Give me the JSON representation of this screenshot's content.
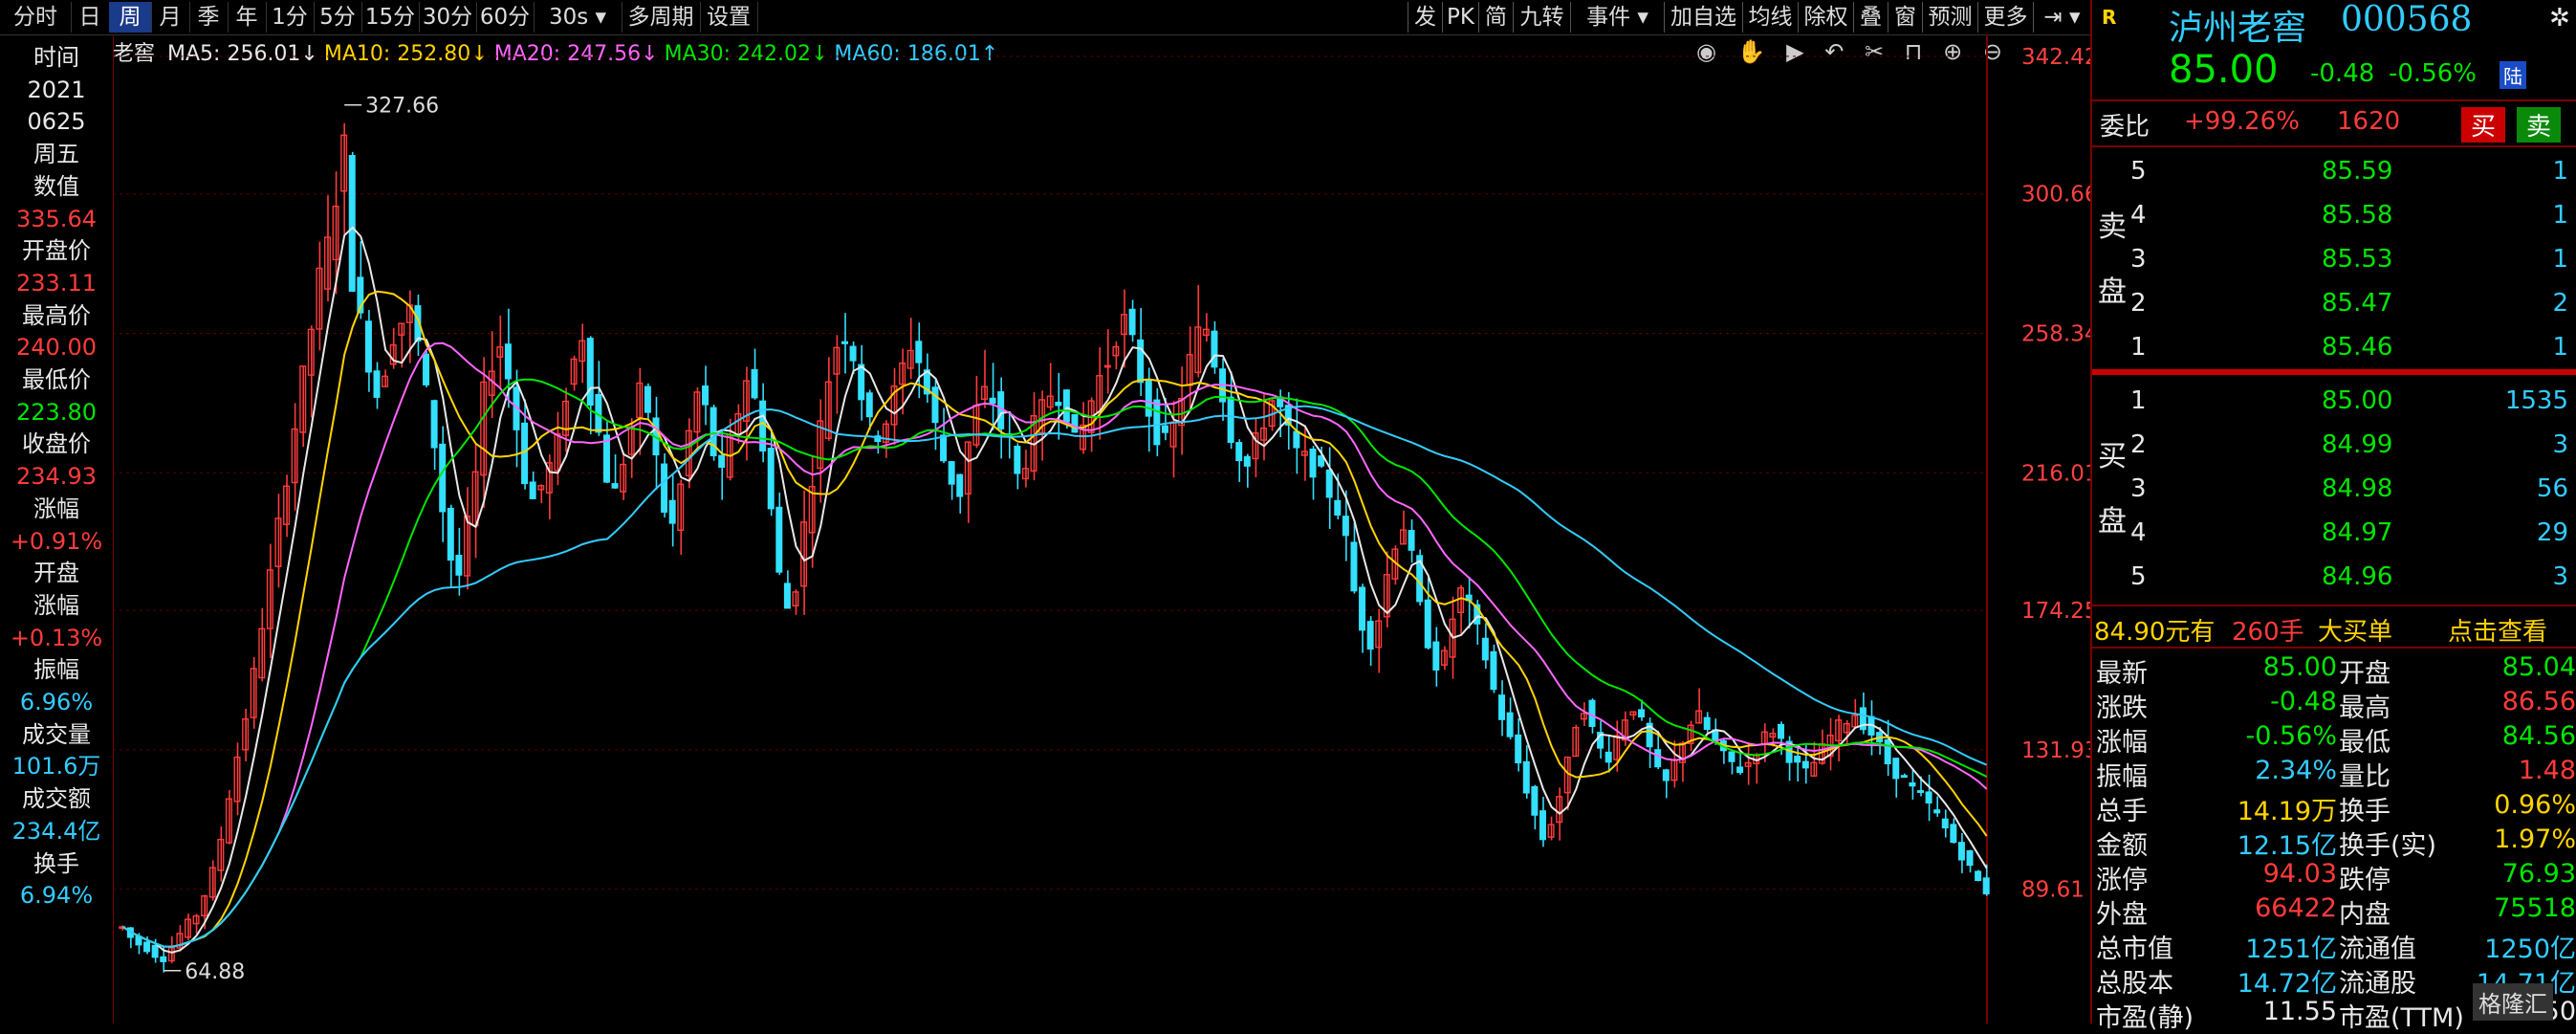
{
  "toolbar": {
    "left": [
      {
        "label": "分时",
        "w": 74
      },
      {
        "label": "日",
        "w": 40
      },
      {
        "label": "周",
        "w": 44,
        "active": true
      },
      {
        "label": "月",
        "w": 40
      },
      {
        "label": "季",
        "w": 40
      },
      {
        "label": "年",
        "w": 40
      },
      {
        "label": "1分",
        "w": 50
      },
      {
        "label": "5分",
        "w": 50
      },
      {
        "label": "15分",
        "w": 60
      },
      {
        "label": "30分",
        "w": 60
      },
      {
        "label": "60分",
        "w": 60
      },
      {
        "label": "30s ▾",
        "w": 92
      },
      {
        "label": "多周期",
        "w": 82
      },
      {
        "label": "设置",
        "w": 60
      }
    ],
    "right": [
      {
        "label": "发",
        "w": 36
      },
      {
        "label": "PK",
        "w": 38
      },
      {
        "label": "简",
        "w": 36
      },
      {
        "label": "九转",
        "w": 60
      },
      {
        "label": "事件 ▾",
        "w": 98
      },
      {
        "label": "加自选",
        "w": 82
      },
      {
        "label": "均线",
        "w": 58
      },
      {
        "label": "除权",
        "w": 58
      },
      {
        "label": "叠",
        "w": 36
      },
      {
        "label": "窗",
        "w": 36
      },
      {
        "label": "预测",
        "w": 58
      },
      {
        "label": "更多",
        "w": 58
      },
      {
        "label": "⇥ ▾",
        "w": 60
      }
    ]
  },
  "left_info": [
    {
      "text": "时间",
      "color": "#e8e8e8"
    },
    {
      "text": "2021",
      "color": "#e8e8e8"
    },
    {
      "text": "0625",
      "color": "#e8e8e8"
    },
    {
      "text": "周五",
      "color": "#e8e8e8"
    },
    {
      "text": "数值",
      "color": "#e8e8e8"
    },
    {
      "text": "335.64",
      "color": "#ff3b3b"
    },
    {
      "text": "开盘价",
      "color": "#e8e8e8"
    },
    {
      "text": "233.11",
      "color": "#ff3b3b"
    },
    {
      "text": "最高价",
      "color": "#e8e8e8"
    },
    {
      "text": "240.00",
      "color": "#ff3b3b"
    },
    {
      "text": "最低价",
      "color": "#e8e8e8"
    },
    {
      "text": "223.80",
      "color": "#00e600"
    },
    {
      "text": "收盘价",
      "color": "#e8e8e8"
    },
    {
      "text": "234.93",
      "color": "#ff3b3b"
    },
    {
      "text": "涨幅",
      "color": "#e8e8e8"
    },
    {
      "text": "+0.91%",
      "color": "#ff3b3b"
    },
    {
      "text": "开盘",
      "color": "#e8e8e8"
    },
    {
      "text": "涨幅",
      "color": "#e8e8e8"
    },
    {
      "text": "+0.13%",
      "color": "#ff3b3b"
    },
    {
      "text": "振幅",
      "color": "#e8e8e8"
    },
    {
      "text": "6.96%",
      "color": "#33ccff"
    },
    {
      "text": "成交量",
      "color": "#e8e8e8"
    },
    {
      "text": "101.6万",
      "color": "#33ccff"
    },
    {
      "text": "成交额",
      "color": "#e8e8e8"
    },
    {
      "text": "234.4亿",
      "color": "#33ccff"
    },
    {
      "text": "换手",
      "color": "#e8e8e8"
    },
    {
      "text": "6.94%",
      "color": "#33ccff"
    }
  ],
  "ma_legend": {
    "stock_short": "老窖",
    "items": [
      {
        "label": "MA5: 256.01↓",
        "color": "#e8e8e8"
      },
      {
        "label": "MA10: 252.80↓",
        "color": "#ffd400"
      },
      {
        "label": "MA20: 247.56↓",
        "color": "#ff66ff"
      },
      {
        "label": "MA30: 242.02↓",
        "color": "#00e600"
      },
      {
        "label": "MA60: 186.01↑",
        "color": "#33ccff"
      }
    ]
  },
  "chart_data": {
    "type": "candlestick",
    "period": "weekly",
    "y_ticks": [
      342.42,
      300.66,
      258.34,
      216.01,
      174.25,
      131.93,
      89.61
    ],
    "ylim": [
      50,
      345
    ],
    "annotations": [
      {
        "label": "327.66",
        "value": 327.66,
        "kind": "high"
      },
      {
        "label": "64.88",
        "value": 64.88,
        "kind": "low"
      }
    ],
    "close_path": [
      78,
      75,
      73,
      72,
      70,
      69,
      72,
      76,
      79,
      82,
      88,
      95,
      105,
      118,
      130,
      142,
      155,
      170,
      185,
      200,
      215,
      230,
      245,
      260,
      275,
      285,
      300,
      315,
      275,
      262,
      250,
      240,
      248,
      258,
      262,
      265,
      255,
      240,
      225,
      205,
      190,
      185,
      200,
      215,
      240,
      250,
      255,
      245,
      230,
      215,
      208,
      212,
      218,
      225,
      240,
      250,
      258,
      240,
      228,
      215,
      210,
      220,
      230,
      240,
      235,
      220,
      205,
      200,
      212,
      228,
      240,
      235,
      222,
      215,
      225,
      235,
      245,
      238,
      225,
      205,
      185,
      175,
      182,
      200,
      215,
      230,
      245,
      255,
      258,
      252,
      240,
      230,
      228,
      232,
      240,
      248,
      255,
      250,
      240,
      230,
      220,
      214,
      210,
      225,
      235,
      240,
      238,
      230,
      225,
      215,
      220,
      230,
      235,
      240,
      240,
      235,
      225,
      230,
      238,
      245,
      250,
      258,
      262,
      255,
      245,
      235,
      228,
      225,
      230,
      240,
      250,
      258,
      260,
      250,
      240,
      228,
      222,
      218,
      225,
      232,
      238,
      235,
      228,
      222,
      220,
      218,
      215,
      210,
      205,
      195,
      180,
      170,
      165,
      172,
      185,
      195,
      200,
      190,
      175,
      165,
      158,
      160,
      172,
      180,
      175,
      168,
      160,
      150,
      142,
      135,
      128,
      120,
      112,
      105,
      110,
      118,
      128,
      140,
      145,
      138,
      132,
      130,
      136,
      142,
      145,
      140,
      132,
      125,
      122,
      128,
      135,
      140,
      142,
      138,
      134,
      130,
      128,
      126,
      128,
      132,
      136,
      138,
      135,
      130,
      127,
      125,
      128,
      132,
      136,
      139,
      141,
      143,
      140,
      137,
      133,
      128,
      125,
      123,
      120,
      118,
      115,
      112,
      108,
      104,
      100,
      96,
      92,
      89
    ],
    "ma_last": {
      "MA5": 256.01,
      "MA10": 252.8,
      "MA20": 247.56,
      "MA30": 242.02,
      "MA60": 186.01
    }
  },
  "quote": {
    "r_label": "R",
    "name": "泸州老窖",
    "code": "000568",
    "price": "85.00",
    "change": "-0.48",
    "change_pct": "-0.56%",
    "market_badge": "陆",
    "weibi_label": "委比",
    "weibi_pct": "+99.26%",
    "weibi_val": "1620",
    "buy_btn": "买",
    "sell_btn": "卖",
    "sell_label": [
      "卖",
      "盘"
    ],
    "buy_label": [
      "买",
      "盘"
    ],
    "sell_levels": [
      {
        "lvl": "5",
        "price": "85.59",
        "vol": "1"
      },
      {
        "lvl": "4",
        "price": "85.58",
        "vol": "1"
      },
      {
        "lvl": "3",
        "price": "85.53",
        "vol": "1"
      },
      {
        "lvl": "2",
        "price": "85.47",
        "vol": "2"
      },
      {
        "lvl": "1",
        "price": "85.46",
        "vol": "1"
      }
    ],
    "buy_levels": [
      {
        "lvl": "1",
        "price": "85.00",
        "vol": "1535"
      },
      {
        "lvl": "2",
        "price": "84.99",
        "vol": "3"
      },
      {
        "lvl": "3",
        "price": "84.98",
        "vol": "56"
      },
      {
        "lvl": "4",
        "price": "84.97",
        "vol": "29"
      },
      {
        "lvl": "5",
        "price": "84.96",
        "vol": "3"
      }
    ],
    "big_order": {
      "price": "84.90元有",
      "hand": "260手",
      "type": "大买单",
      "link": "点击查看"
    },
    "stats": [
      {
        "k1": "最新",
        "v1": "85.00",
        "c1": "#00e600",
        "k2": "开盘",
        "v2": "85.04",
        "c2": "#00e600"
      },
      {
        "k1": "涨跌",
        "v1": "-0.48",
        "c1": "#00e600",
        "k2": "最高",
        "v2": "86.56",
        "c2": "#ff3b3b"
      },
      {
        "k1": "涨幅",
        "v1": "-0.56%",
        "c1": "#00e600",
        "k2": "最低",
        "v2": "84.56",
        "c2": "#00e600"
      },
      {
        "k1": "振幅",
        "v1": "2.34%",
        "c1": "#33ccff",
        "k2": "量比",
        "v2": "1.48",
        "c2": "#ff3b3b"
      },
      {
        "k1": "总手",
        "v1": "14.19万",
        "c1": "#ffd400",
        "k2": "换手",
        "v2": "0.96%",
        "c2": "#ffd400"
      },
      {
        "k1": "金额",
        "v1": "12.15亿",
        "c1": "#33ccff",
        "k2": "换手(实)",
        "v2": "1.97%",
        "c2": "#ffd400"
      },
      {
        "k1": "涨停",
        "v1": "94.03",
        "c1": "#ff3b3b",
        "k2": "跌停",
        "v2": "76.93",
        "c2": "#00e600"
      },
      {
        "k1": "外盘",
        "v1": "66422",
        "c1": "#ff3b3b",
        "k2": "内盘",
        "v2": "75518",
        "c2": "#00e600"
      },
      {
        "k1": "总市值",
        "v1": "1251亿",
        "c1": "#33ccff",
        "k2": "流通值",
        "v2": "1250亿",
        "c2": "#33ccff"
      },
      {
        "k1": "总股本",
        "v1": "14.72亿",
        "c1": "#33ccff",
        "k2": "流通股",
        "v2": "14.71亿",
        "c2": "#33ccff"
      },
      {
        "k1": "市盈(静)",
        "v1": "11.55",
        "c1": "#e8e8e8",
        "k2": "市盈(TTM)",
        "v2": "12.50",
        "c2": "#e8e8e8"
      }
    ],
    "watermark": "格隆汇"
  }
}
